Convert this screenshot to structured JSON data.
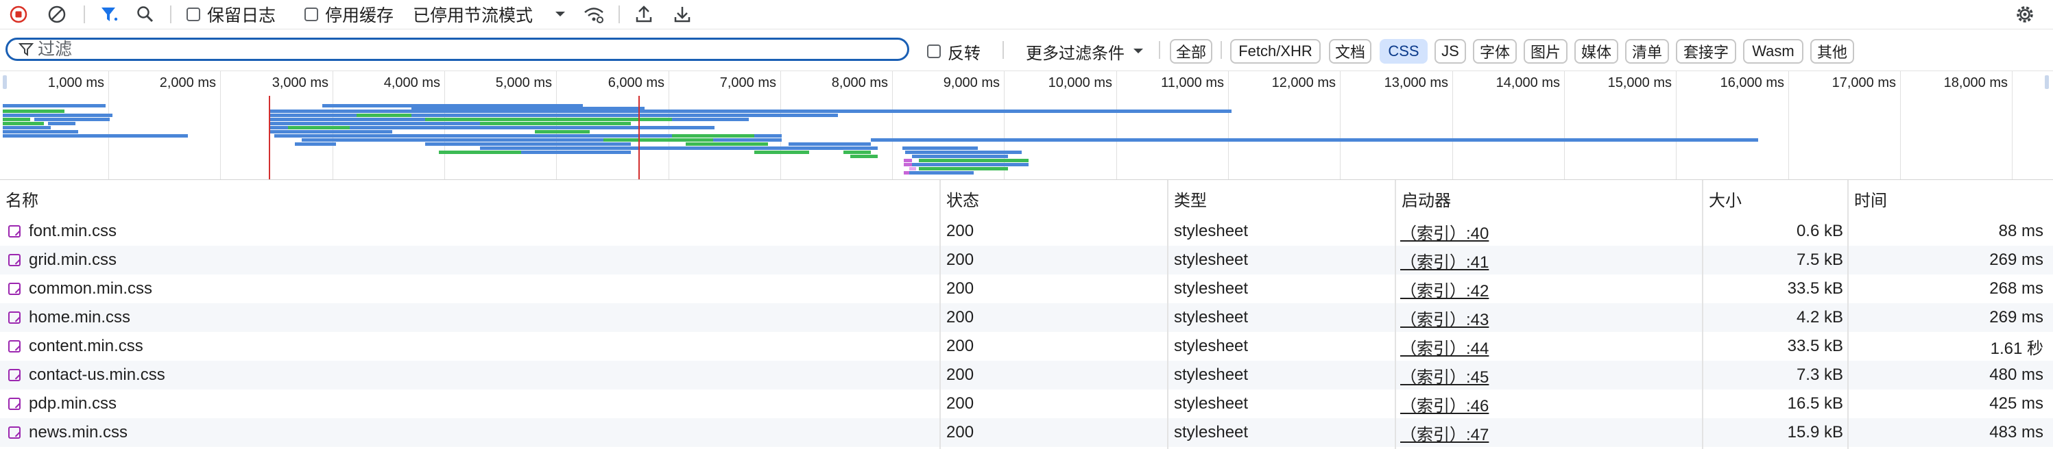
{
  "toolbar": {
    "preserve_log": "保留日志",
    "disable_cache": "停用缓存",
    "throttle": "已停用节流模式"
  },
  "filter": {
    "placeholder": "过滤",
    "invert": "反转",
    "more_filters": "更多过滤条件",
    "types": [
      "全部",
      "Fetch/XHR",
      "文档",
      "CSS",
      "JS",
      "字体",
      "图片",
      "媒体",
      "清单",
      "套接字",
      "Wasm",
      "其他"
    ],
    "active_type": "CSS"
  },
  "overview": {
    "ticks": [
      "1,000 ms",
      "2,000 ms",
      "3,000 ms",
      "4,000 ms",
      "5,000 ms",
      "6,000 ms",
      "7,000 ms",
      "8,000 ms",
      "9,000 ms",
      "10,000 ms",
      "11,000 ms",
      "12,000 ms",
      "13,000 ms",
      "14,000 ms",
      "15,000 ms",
      "16,000 ms",
      "17,000 ms",
      "18,000 ms"
    ],
    "markers_ms": [
      2400,
      5700
    ]
  },
  "table": {
    "headers": {
      "name": "名称",
      "status": "状态",
      "type": "类型",
      "initiator": "启动器",
      "size": "大小",
      "time": "时间"
    },
    "rows": [
      {
        "name": "font.min.css",
        "status": "200",
        "type": "stylesheet",
        "initiator": "（索引）:40",
        "size": "0.6 kB",
        "time": "88 ms"
      },
      {
        "name": "grid.min.css",
        "status": "200",
        "type": "stylesheet",
        "initiator": "（索引）:41",
        "size": "7.5 kB",
        "time": "269 ms"
      },
      {
        "name": "common.min.css",
        "status": "200",
        "type": "stylesheet",
        "initiator": "（索引）:42",
        "size": "33.5 kB",
        "time": "268 ms"
      },
      {
        "name": "home.min.css",
        "status": "200",
        "type": "stylesheet",
        "initiator": "（索引）:43",
        "size": "4.2 kB",
        "time": "269 ms"
      },
      {
        "name": "content.min.css",
        "status": "200",
        "type": "stylesheet",
        "initiator": "（索引）:44",
        "size": "33.5 kB",
        "time": "1.61 秒"
      },
      {
        "name": "contact-us.min.css",
        "status": "200",
        "type": "stylesheet",
        "initiator": "（索引）:45",
        "size": "7.3 kB",
        "time": "480 ms"
      },
      {
        "name": "pdp.min.css",
        "status": "200",
        "type": "stylesheet",
        "initiator": "（索引）:46",
        "size": "16.5 kB",
        "time": "425 ms"
      },
      {
        "name": "news.min.css",
        "status": "200",
        "type": "stylesheet",
        "initiator": "（索引）:47",
        "size": "15.9 kB",
        "time": "483 ms"
      }
    ]
  },
  "colors": {
    "accent": "#1a5fb4",
    "record": "#d93025",
    "bar_blue": "#4a86d8",
    "bar_green": "#3cba54",
    "marker_red": "#d32f2f",
    "row_alt": "#f5f7fa"
  }
}
